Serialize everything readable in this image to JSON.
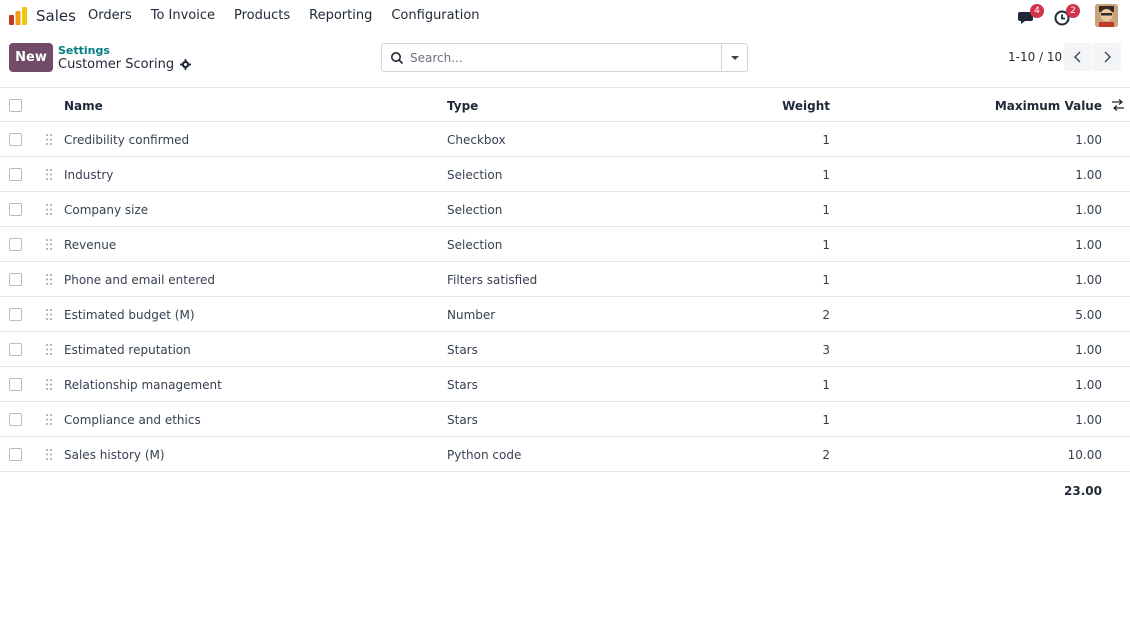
{
  "navbar": {
    "app_name": "Sales",
    "menu": [
      "Orders",
      "To Invoice",
      "Products",
      "Reporting",
      "Configuration"
    ],
    "messages_count": "4",
    "activities_count": "2"
  },
  "control_panel": {
    "new_label": "New",
    "breadcrumb_parent": "Settings",
    "breadcrumb_current": "Customer Scoring",
    "search_placeholder": "Search...",
    "pager_value": "1-10 / 10"
  },
  "table": {
    "columns": {
      "name": "Name",
      "type": "Type",
      "weight": "Weight",
      "max": "Maximum Value"
    },
    "rows": [
      {
        "name": "Credibility confirmed",
        "type": "Checkbox",
        "weight": "1",
        "max": "1.00"
      },
      {
        "name": "Industry",
        "type": "Selection",
        "weight": "1",
        "max": "1.00"
      },
      {
        "name": "Company size",
        "type": "Selection",
        "weight": "1",
        "max": "1.00"
      },
      {
        "name": "Revenue",
        "type": "Selection",
        "weight": "1",
        "max": "1.00"
      },
      {
        "name": "Phone and email entered",
        "type": "Filters satisfied",
        "weight": "1",
        "max": "1.00"
      },
      {
        "name": "Estimated budget (M)",
        "type": "Number",
        "weight": "2",
        "max": "5.00"
      },
      {
        "name": "Estimated reputation",
        "type": "Stars",
        "weight": "3",
        "max": "1.00"
      },
      {
        "name": "Relationship management",
        "type": "Stars",
        "weight": "1",
        "max": "1.00"
      },
      {
        "name": "Compliance and ethics",
        "type": "Stars",
        "weight": "1",
        "max": "1.00"
      },
      {
        "name": "Sales history (M)",
        "type": "Python code",
        "weight": "2",
        "max": "10.00"
      }
    ],
    "total_max": "23.00"
  },
  "colors": {
    "brand": "#714b67",
    "link": "#017e84",
    "badge": "#d0334a"
  }
}
